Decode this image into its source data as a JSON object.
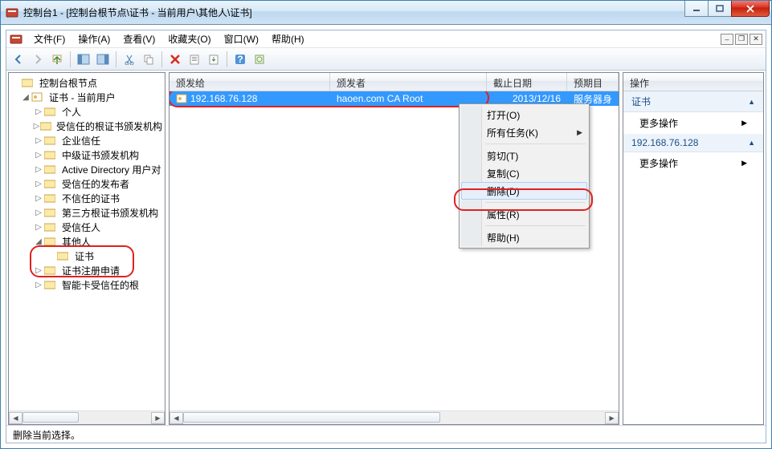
{
  "window": {
    "title": "控制台1 - [控制台根节点\\证书 - 当前用户\\其他人\\证书]"
  },
  "menu": {
    "file": "文件(F)",
    "action": "操作(A)",
    "view": "查看(V)",
    "favorites": "收藏夹(O)",
    "window": "窗口(W)",
    "help": "帮助(H)"
  },
  "tree": {
    "root": "控制台根节点",
    "cert_user": "证书 - 当前用户",
    "nodes": {
      "personal": "个人",
      "trusted_root": "受信任的根证书颁发机构",
      "ent_trust": "企业信任",
      "intermediate": "中级证书颁发机构",
      "ad_user": "Active Directory 用户对",
      "trusted_pub": "受信任的发布者",
      "untrusted": "不信任的证书",
      "third_party": "第三方根证书颁发机构",
      "trusted_people": "受信任人",
      "others": "其他人",
      "certs": "证书",
      "cert_enroll": "证书注册申请",
      "smart_card": "智能卡受信任的根"
    }
  },
  "list": {
    "columns": {
      "issued_to": "颁发给",
      "issued_by": "颁发者",
      "expiry": "截止日期",
      "purpose": "预期目的"
    },
    "row": {
      "issued_to": "192.168.76.128",
      "issued_by": "haoen.com CA Root",
      "expiry": "2013/12/16",
      "purpose": "服务器身"
    },
    "widths": {
      "c1": 200,
      "c2": 195,
      "c3": 100,
      "c4": 50
    }
  },
  "context": {
    "open": "打开(O)",
    "all_tasks": "所有任务(K)",
    "cut": "剪切(T)",
    "copy": "复制(C)",
    "delete": "删除(D)",
    "properties": "属性(R)",
    "help": "帮助(H)"
  },
  "actions": {
    "header": "操作",
    "cert_section": "证书",
    "more_ops": "更多操作",
    "ip_section": "192.168.76.128"
  },
  "status": "删除当前选择。"
}
